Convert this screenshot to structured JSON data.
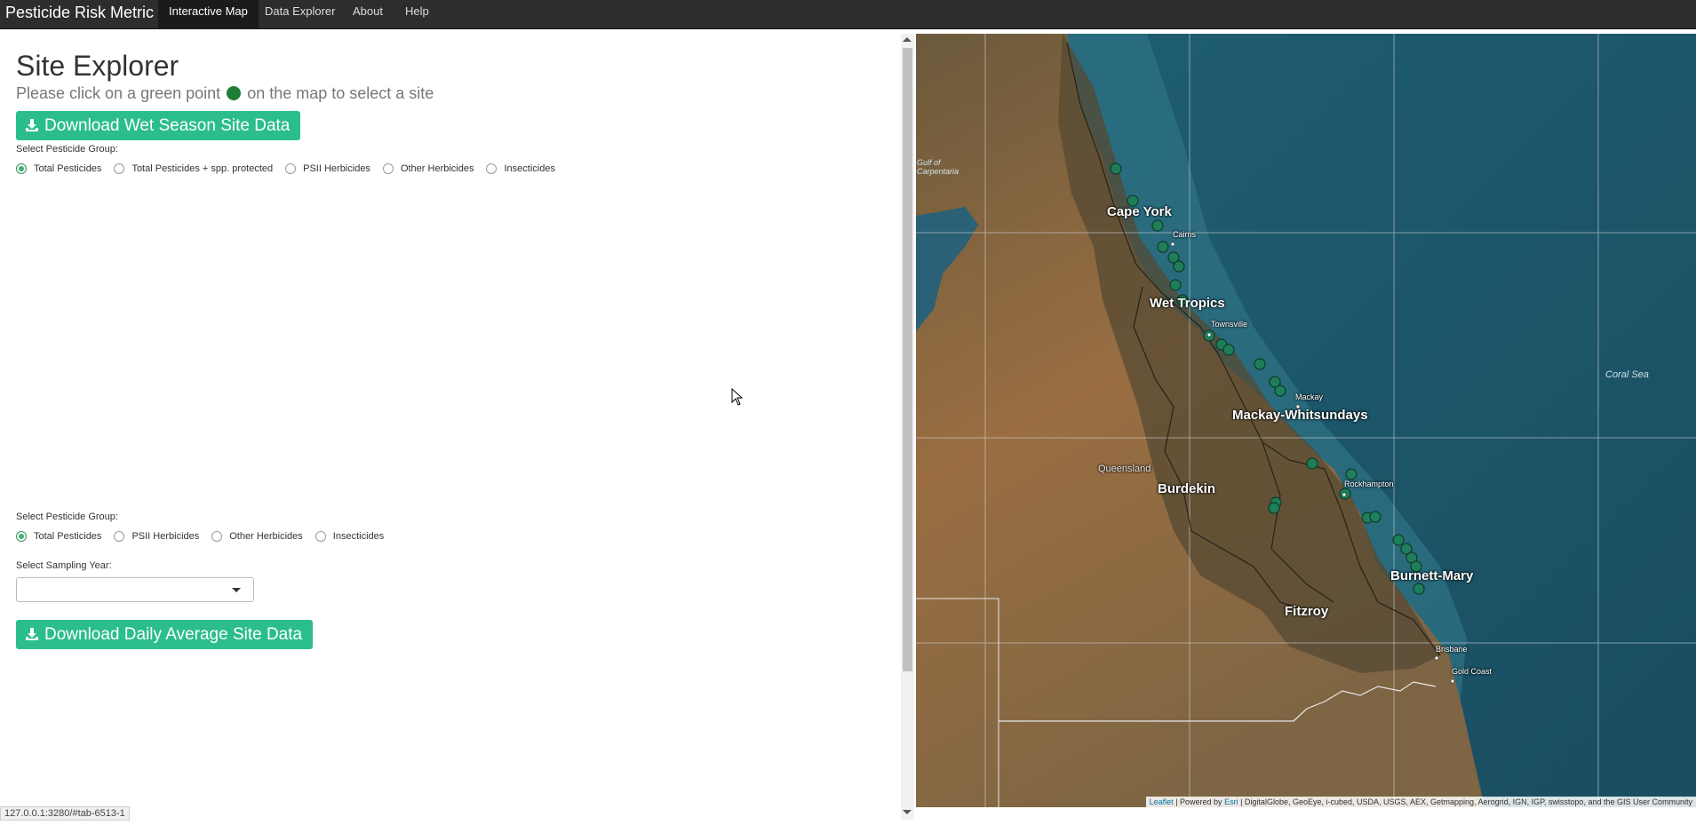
{
  "navbar": {
    "brand": "Pesticide Risk Metric",
    "tabs": [
      {
        "label": "Interactive Map",
        "active": true
      },
      {
        "label": "Data Explorer",
        "active": false
      },
      {
        "label": "About",
        "active": false
      },
      {
        "label": "Help",
        "active": false
      }
    ],
    "bg_color": "#2d2d2d"
  },
  "site_explorer": {
    "title": "Site Explorer",
    "instruction_before": "Please click on a green point",
    "instruction_after": "on the map to select a site",
    "download_wet_label": "Download Wet Season Site Data",
    "group1": {
      "label": "Select Pesticide Group:",
      "options": [
        "Total Pesticides",
        "Total Pesticides + spp. protected",
        "PSII Herbicides",
        "Other Herbicides",
        "Insecticides"
      ],
      "selected": "Total Pesticides"
    },
    "group2": {
      "label": "Select Pesticide Group:",
      "options": [
        "Total Pesticides",
        "PSII Herbicides",
        "Other Herbicides",
        "Insecticides"
      ],
      "selected": "Total Pesticides"
    },
    "year": {
      "label": "Select Sampling Year:",
      "value": ""
    },
    "download_daily_label": "Download Daily Average Site Data",
    "accent_color": "#2bbd8e"
  },
  "status_url": "127.0.0.1:3280/#tab-6513-1",
  "map": {
    "regions": [
      "Cape York",
      "Wet Tropics",
      "Mackay-Whitsundays",
      "Burdekin",
      "Fitzroy",
      "Burnett-Mary"
    ],
    "cities": [
      "Cairns",
      "Townsville",
      "Mackay",
      "Rockhampton",
      "Brisbane",
      "Gold Coast"
    ],
    "state": "Queensland",
    "gulf": "Gulf of Carpentaria",
    "sea": "Coral Sea",
    "attribution": {
      "leaflet": "Leaflet",
      "powered": "| Powered by",
      "esri": "Esri",
      "sources": "| DigitalGlobe, GeoEye, i-cubed, USDA, USGS, AEX, Getmapping, Aerogrid, IGN, IGP, swisstopo, and the GIS User Community"
    },
    "site_color": "#1e7e5a"
  }
}
